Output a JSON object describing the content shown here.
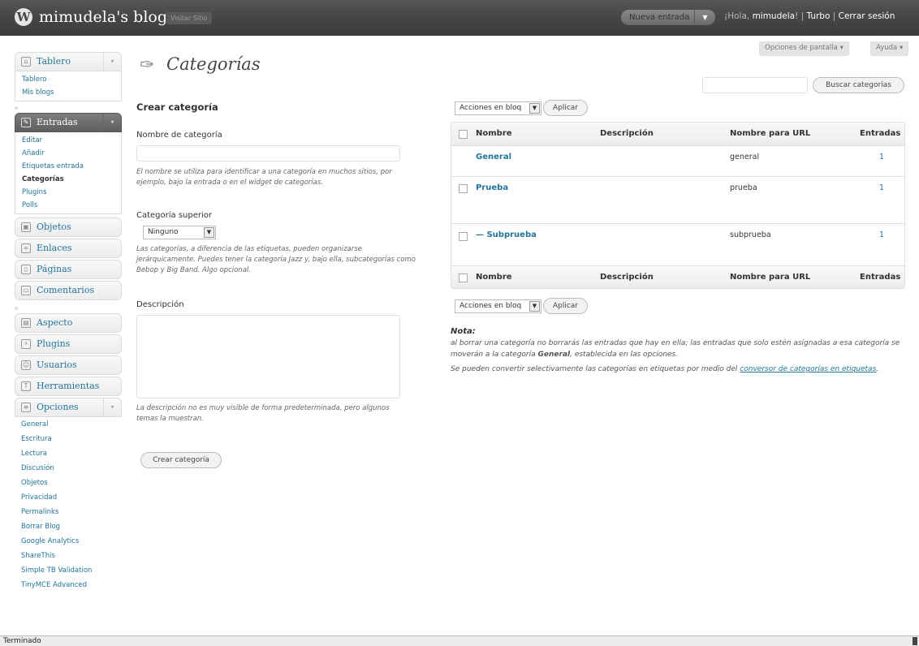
{
  "topbar": {
    "site_title": "mimudela's blog",
    "visit_site": "Visitar Sitio",
    "new_post": "Nueva entrada",
    "greeting_prefix": "¡Hola, ",
    "username": "mimudela",
    "greeting_suffix": "! | ",
    "turbo": "Turbo",
    "divider": " | ",
    "logout": "Cerrar sesión"
  },
  "screen_options": "Opciones de pantalla",
  "help": "Ayuda",
  "page_title": "Categorías",
  "sidebar": {
    "dashboard": "Tablero",
    "dashboard_items": [
      "Tablero",
      "Mis blogs"
    ],
    "posts": "Entradas",
    "posts_items": [
      "Editar",
      "Añadir",
      "Etiquetas entrada",
      "Categorías",
      "Plugins",
      "Polls"
    ],
    "media": "Objetos",
    "links": "Enlaces",
    "pages": "Páginas",
    "comments": "Comentarios",
    "appearance": "Aspecto",
    "plugins": "Plugins",
    "users": "Usuarios",
    "tools": "Herramientas",
    "settings": "Opciones",
    "settings_items": [
      "General",
      "Escritura",
      "Lectura",
      "Discusión",
      "Objetos",
      "Privacidad",
      "Permalinks",
      "Borrar Blog",
      "Google Analytics",
      "ShareThis",
      "Simple TB Validation",
      "TinyMCE Advanced"
    ]
  },
  "form": {
    "title": "Crear categoría",
    "name_label": "Nombre de categoría",
    "name_value": "",
    "name_hint": "El nombre se utiliza para identificar a una categoría en muchos sitios, por ejemplo, bajo la entrada o en el widget de categorías.",
    "parent_label": "Categoría superior",
    "parent_value": "Ninguno",
    "parent_hint": "Las categorías, a diferencia de las etiquetas, pueden organizarse jerárquicamente. Puedes tener la categoría Jazz y, bajo ella, subcategorías como Bebop y Big Band. Algo opcional.",
    "desc_label": "Descripción",
    "desc_value": "",
    "desc_hint": "La descripción no es muy visible de forma predeterminada, pero algunos temas la muestran.",
    "submit": "Crear categoría"
  },
  "search": {
    "button": "Buscar categorías",
    "value": ""
  },
  "bulk": {
    "select": "Acciones en bloq",
    "apply": "Aplicar"
  },
  "table": {
    "headers": [
      "Nombre",
      "Descripción",
      "Nombre para URL",
      "Entradas"
    ],
    "rows": [
      {
        "name": "General",
        "description": "",
        "slug": "general",
        "count": "1",
        "has_checkbox": false
      },
      {
        "name": "Prueba",
        "description": "",
        "slug": "prueba",
        "count": "1",
        "has_checkbox": true
      },
      {
        "name": "— Subprueba",
        "description": "",
        "slug": "subprueba",
        "count": "1",
        "has_checkbox": true
      }
    ]
  },
  "note": {
    "title": "Nota:",
    "line1_a": "al borrar una categoría no borrarás las entradas que hay en ella; las entradas que solo estén asignadas a esa categoría se moverán a la categoría ",
    "line1_b": "General",
    "line1_c": ", establecida en las opciones.",
    "line2_a": "Se pueden convertir selectivamente las categorías en etiquetas por medio del ",
    "line2_link": "conversor de categorías en etiquetas",
    "line2_c": "."
  },
  "statusbar": "Terminado"
}
